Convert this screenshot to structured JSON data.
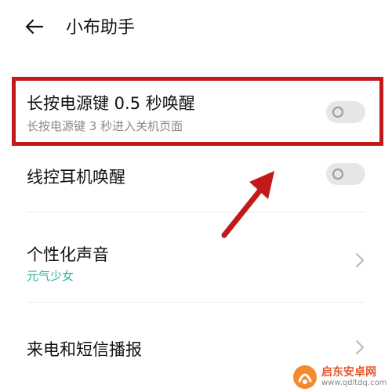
{
  "header": {
    "back_icon": "arrow-left-icon",
    "title": "小布助手"
  },
  "settings": [
    {
      "label": "长按电源键 0.5 秒唤醒",
      "description": "长按电源键 3 秒进入关机页面",
      "control": "toggle",
      "enabled": false
    },
    {
      "label": "线控耳机唤醒",
      "control": "toggle",
      "enabled": false
    },
    {
      "label": "个性化声音",
      "value": "元气少女",
      "control": "chevron"
    },
    {
      "label": "来电和短信播报",
      "control": "chevron"
    }
  ],
  "watermark": {
    "brand": "启东安卓网",
    "url": "www.qdltdq.com"
  },
  "colors": {
    "highlight": "#c2191a",
    "arrow": "#c2191a",
    "accent_green": "#27b59b",
    "toggle_off": "#e6e6e6"
  }
}
